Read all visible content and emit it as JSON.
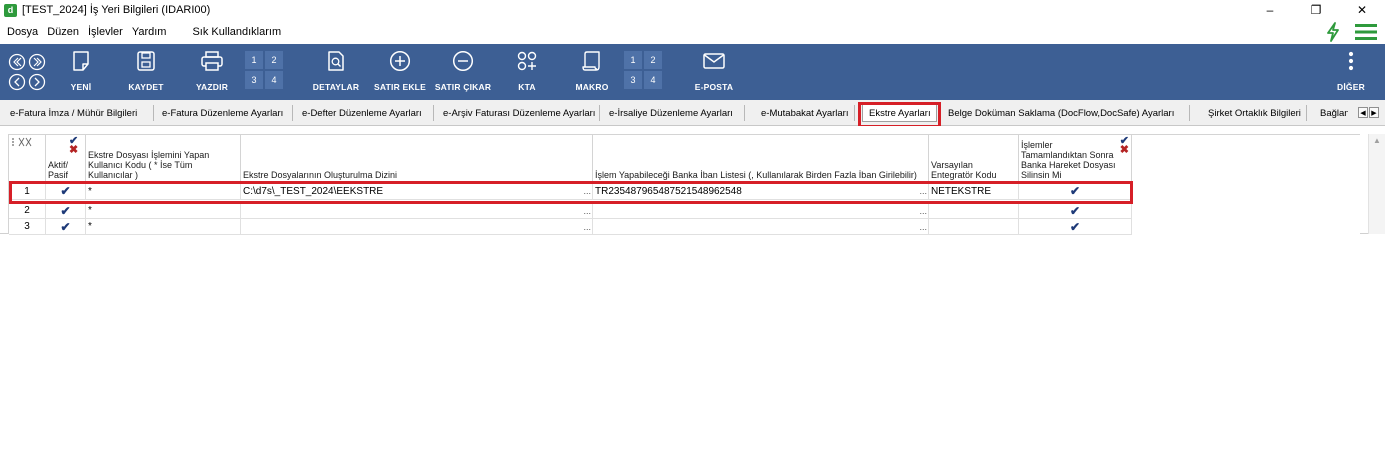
{
  "window": {
    "app_icon_letter": "d",
    "title": "[TEST_2024] İş Yeri Bilgileri (IDARI00)",
    "minimize": "–",
    "restore": "❐",
    "close": "✕"
  },
  "menu": {
    "items": [
      "Dosya",
      "Düzen",
      "İşlevler",
      "Yardım"
    ],
    "favorites": "Sık Kullandıklarım"
  },
  "toolbar": {
    "buttons": {
      "yeni": "YENİ",
      "kaydet": "KAYDET",
      "yazdir": "YAZDIR",
      "detaylar": "DETAYLAR",
      "satir_ekle": "SATIR EKLE",
      "satir_cikar": "SATIR ÇIKAR",
      "kta": "KTA",
      "makro": "MAKRO",
      "eposta": "E-POSTA",
      "diger": "DİĞER"
    },
    "page_grid_1": [
      "1",
      "2",
      "3",
      "4"
    ],
    "page_grid_2": [
      "1",
      "2",
      "3",
      "4"
    ]
  },
  "tabs": [
    {
      "label": "e-Fatura İmza / Mühür Bilgileri"
    },
    {
      "label": "e-Fatura Düzenleme Ayarları"
    },
    {
      "label": "e-Defter Düzenleme Ayarları"
    },
    {
      "label": "e-Arşiv Faturası Düzenleme Ayarları"
    },
    {
      "label": "e-İrsaliye Düzenleme Ayarları"
    },
    {
      "label": "e-Mutabakat Ayarları"
    },
    {
      "label": "Ekstre Ayarları"
    },
    {
      "label": "Belge Doküman Saklama (DocFlow,DocSafe) Ayarları"
    },
    {
      "label": "Şirket Ortaklık Bilgileri"
    },
    {
      "label": "Bağlantı"
    }
  ],
  "active_tab": "Ekstre Ayarları",
  "grid": {
    "headers": {
      "aktif": "Aktif/\nPasif",
      "kullanici": "Ekstre Dosyası İşlemini Yapan Kullanıcı Kodu ( * İse Tüm Kullanıcılar )",
      "dizin": "Ekstre Dosyalarının Oluşturulma Dizini",
      "iban": "İşlem Yapabileceği Banka İban Listesi (, Kullanılarak Birden Fazla İban Girilebilir)",
      "entegrator": "Varsayılan Entegratör Kodu",
      "silinsin": "İşlemler Tamamlandıktan Sonra Banka Hareket Dosyası Silinsin Mi"
    },
    "rows": [
      {
        "no": "1",
        "aktif": "✔",
        "kullanici": "*",
        "dizin": "C:\\d7s\\_TEST_2024\\EEKSTRE",
        "iban": "TR235487965487521548962548",
        "entegrator": "NETEKSTRE",
        "silinsin": "✔"
      },
      {
        "no": "2",
        "aktif": "✔",
        "kullanici": "*",
        "dizin": "",
        "iban": "",
        "entegrator": "",
        "silinsin": "✔"
      },
      {
        "no": "3",
        "aktif": "✔",
        "kullanici": "*",
        "dizin": "",
        "iban": "",
        "entegrator": "",
        "silinsin": "✔"
      }
    ],
    "ellipsis": "..."
  },
  "colors": {
    "toolbar_bg": "#3d5f94",
    "highlight": "#d61f27",
    "check": "#1e3a78",
    "accent_green": "#2e9a3c"
  }
}
